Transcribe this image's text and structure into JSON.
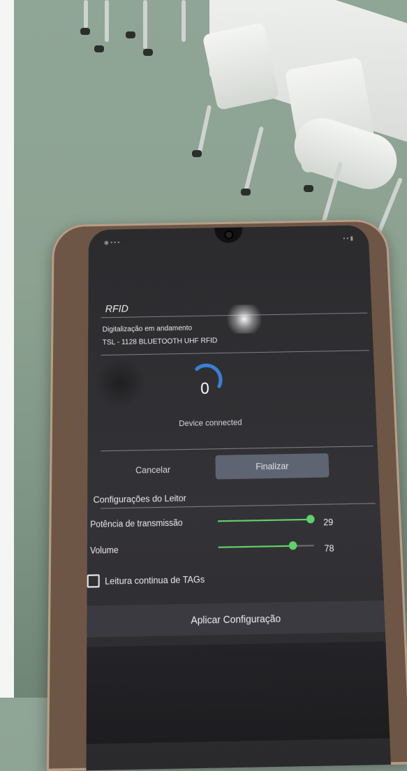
{
  "app": {
    "title": "RFID",
    "status": "Digitalização em andamento",
    "device": "TSL - 1128 BLUETOOTH UHF RFID"
  },
  "scan": {
    "count": "0",
    "connection": "Device connected",
    "accent_color": "#3b7fd4"
  },
  "actions": {
    "cancel_label": "Cancelar",
    "finalize_label": "Finalizar"
  },
  "settings": {
    "section_title": "Configurações do Leitor",
    "power": {
      "label": "Potência de transmissão",
      "value": "29",
      "level": 0.97
    },
    "volume": {
      "label": "Volume",
      "value": "78",
      "level": 0.78
    },
    "continuous_read": {
      "label": "Leitura continua de TAGs",
      "checked": false
    },
    "apply_label": "Aplicar Configuração",
    "slider_color": "#5fd06b"
  }
}
